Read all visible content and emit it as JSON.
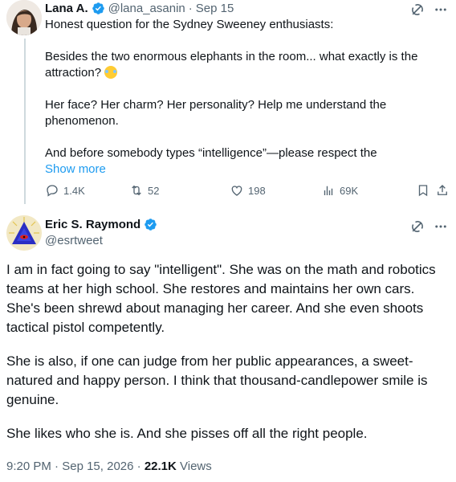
{
  "quoted_tweet": {
    "author_name": "Lana A.",
    "handle": "@lana_asanin",
    "separator": "·",
    "date": "Sep 15",
    "body_lines": [
      "Honest question for the Sydney Sweeney enthusiasts:",
      "Besides the two enormous elephants in the room... what exactly is the attraction?",
      "Her face? Her charm? Her personality? Help me understand the phenomenon.",
      "And before somebody types “intelligence”—please respect the"
    ],
    "show_more": "Show more",
    "actions": {
      "replies": "1.4K",
      "reposts": "52",
      "likes": "198",
      "views": "69K"
    },
    "icons": [
      "grok-icon",
      "more-icon",
      "reply-icon",
      "repost-icon",
      "like-icon",
      "views-icon",
      "bookmark-icon",
      "share-icon"
    ]
  },
  "main_tweet": {
    "author_name": "Eric S. Raymond",
    "handle": "@esrtweet",
    "paragraphs": [
      "I am in fact going to say \"intelligent\". She was on the math and robotics teams at her high school. She restores and maintains her own cars. She's been shrewd about managing her career. And she even shoots tactical pistol competently.",
      "She is also, if one can judge from her public appearances, a sweet-natured and happy person. I think that thousand-candlepower smile is genuine.",
      "She likes who she is. And she pisses off all the right people."
    ],
    "time": "9:20 PM",
    "separator": "·",
    "date": "Sep 15, 2026",
    "meta_separator": "·",
    "views_count": "22.1K",
    "views_label": "Views"
  },
  "colors": {
    "text": "#0f1419",
    "muted": "#536471",
    "link": "#1d9bf0",
    "verified": "#1d9bf0",
    "rail": "#cfd9de"
  }
}
